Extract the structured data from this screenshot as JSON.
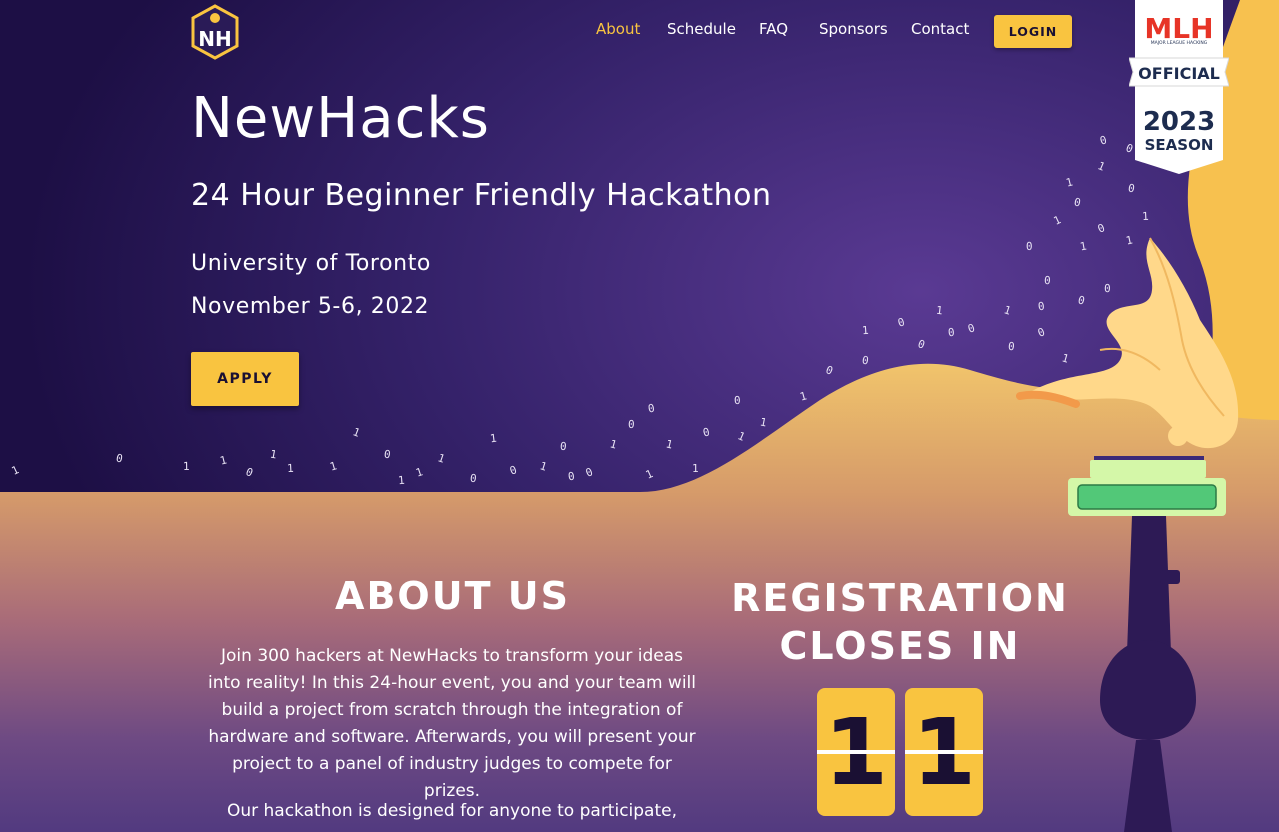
{
  "brand": {
    "logo_letters": "NH"
  },
  "nav": {
    "links": [
      "About",
      "Schedule",
      "FAQ",
      "Sponsors",
      "Contact"
    ],
    "active": "About",
    "login_label": "LOGIN"
  },
  "hero": {
    "title": "NewHacks",
    "subtitle": "24 Hour Beginner Friendly Hackathon",
    "location": "University of Toronto",
    "date": "November 5-6, 2022",
    "apply_label": "APPLY"
  },
  "mlh_badge": {
    "logo": "MLH",
    "tagline": "MAJOR LEAGUE HACKING",
    "official": "OFFICIAL",
    "season_year": "2023",
    "season_label": "SEASON"
  },
  "about": {
    "heading": "ABOUT US",
    "paragraph1": "Join 300 hackers at NewHacks to transform your ideas into reality! In this 24-hour event, you and your team will build a project from scratch through the integration of hardware and software. Afterwards, you will present your project to a panel of industry judges to compete for prizes.",
    "paragraph2": "Our hackathon is designed for anyone to participate,"
  },
  "registration": {
    "heading": "REGISTRATION CLOSES IN",
    "digits": [
      "1",
      "1"
    ]
  },
  "binary_stream": [
    "1",
    "0",
    "1",
    "1",
    "0",
    "1",
    "1",
    "1",
    "1",
    "0",
    "1",
    "1",
    "1",
    "0",
    "1",
    "0",
    "1",
    "0",
    "0",
    "0",
    "1",
    "0",
    "0",
    "1",
    "1",
    "1",
    "0",
    "1",
    "1",
    "0",
    "1",
    "0",
    "0",
    "1",
    "0",
    "0",
    "1",
    "0",
    "0",
    "1",
    "0",
    "0",
    "0",
    "1",
    "0",
    "1",
    "0",
    "0",
    "0",
    "1",
    "1",
    "0",
    "0",
    "1",
    "1",
    "0",
    "1",
    "0",
    "0",
    "1",
    "0",
    "1",
    "0",
    "1",
    "0",
    "1",
    "0",
    "1"
  ],
  "colors": {
    "accent": "#f9c440",
    "navy": "#1d0f45",
    "purple": "#4b2d80",
    "sand": "#f0c06a"
  }
}
